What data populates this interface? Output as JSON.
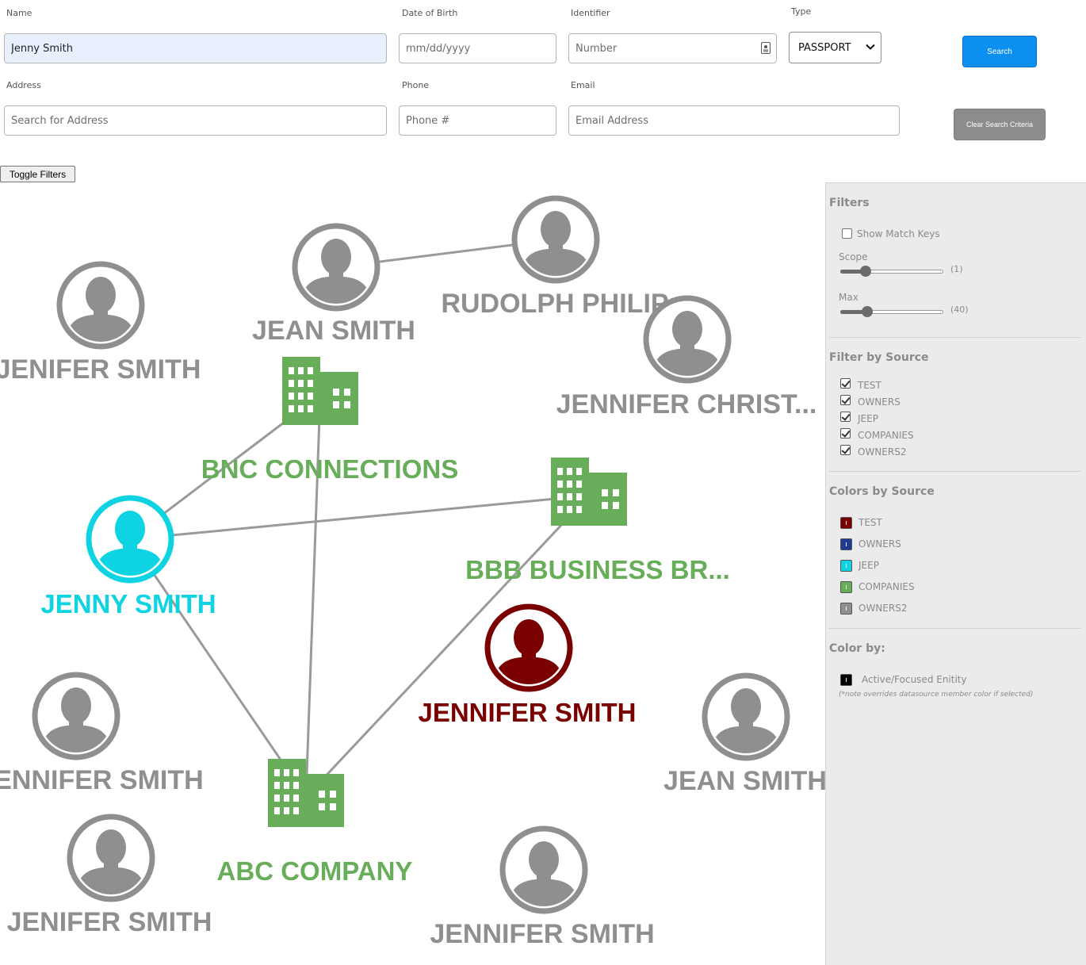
{
  "search": {
    "name_label": "Name",
    "name_value": "Jenny Smith",
    "dob_label": "Date of Birth",
    "dob_placeholder": "mm/dd/yyyy",
    "identifier_label": "Identifier",
    "identifier_placeholder": "Number",
    "type_label": "Type",
    "type_value": "PASSPORT",
    "search_button": "Search",
    "address_label": "Address",
    "address_placeholder": "Search for Address",
    "phone_label": "Phone",
    "phone_placeholder": "Phone #",
    "email_label": "Email",
    "email_placeholder": "Email Address",
    "clear_button": "Clear Search Criteria",
    "toggle_filters": "Toggle Filters"
  },
  "graph": {
    "nodes": [
      {
        "id": "jean-smith-top",
        "kind": "person",
        "label": "JEAN SMITH",
        "color": "#8f8f8f"
      },
      {
        "id": "rudolph",
        "kind": "person",
        "label": "RUDOLPH PHILIP",
        "color": "#8f8f8f"
      },
      {
        "id": "jenifer-left",
        "kind": "person",
        "label": "JENIFER SMITH",
        "color": "#8f8f8f"
      },
      {
        "id": "jennifer-christ",
        "kind": "person",
        "label": "JENNIFER CHRIST...",
        "color": "#8f8f8f"
      },
      {
        "id": "bnc",
        "kind": "company",
        "label": "BNC CONNECTIONS",
        "color": "#68ad5a"
      },
      {
        "id": "bbb",
        "kind": "company",
        "label": "BBB BUSINESS BR...",
        "color": "#68ad5a"
      },
      {
        "id": "jenny",
        "kind": "person",
        "label": "JENNY SMITH",
        "color": "#0ed3e3"
      },
      {
        "id": "jennifer-red",
        "kind": "person",
        "label": "JENNIFER SMITH",
        "color": "#7a0000"
      },
      {
        "id": "jennifer-bl",
        "kind": "person",
        "label": "JENNIFER SMITH",
        "color": "#8f8f8f"
      },
      {
        "id": "jean-smith-right",
        "kind": "person",
        "label": "JEAN SMITH",
        "color": "#8f8f8f"
      },
      {
        "id": "abc",
        "kind": "company",
        "label": "ABC COMPANY",
        "color": "#68ad5a"
      },
      {
        "id": "jenifer-bottom",
        "kind": "person",
        "label": "JENIFER SMITH",
        "color": "#8f8f8f"
      },
      {
        "id": "jennifer-bottom",
        "kind": "person",
        "label": "JENNIFER SMITH",
        "color": "#8f8f8f"
      }
    ],
    "edges": [
      [
        "jean-smith-top",
        "rudolph"
      ],
      [
        "bnc",
        "jenny"
      ],
      [
        "bnc",
        "abc"
      ],
      [
        "jenny",
        "bbb"
      ],
      [
        "jenny",
        "abc"
      ],
      [
        "bbb",
        "abc"
      ]
    ]
  },
  "filters": {
    "title": "Filters",
    "show_match_keys": "Show Match Keys",
    "show_match_keys_checked": false,
    "scope_label": "Scope",
    "scope_value": "(1)",
    "scope_level": 1,
    "max_label": "Max",
    "max_value": "(40)",
    "max_level": 40,
    "filter_by_source_title": "Filter by Source",
    "sources": [
      {
        "name": "TEST",
        "checked": true
      },
      {
        "name": "OWNERS",
        "checked": true
      },
      {
        "name": "JEEP",
        "checked": true
      },
      {
        "name": "COMPANIES",
        "checked": true
      },
      {
        "name": "OWNERS2",
        "checked": true
      }
    ],
    "colors_by_source_title": "Colors by Source",
    "colors": [
      {
        "name": "TEST",
        "color": "#7a0000"
      },
      {
        "name": "OWNERS",
        "color": "#1f3a93"
      },
      {
        "name": "JEEP",
        "color": "#0ed3e3"
      },
      {
        "name": "COMPANIES",
        "color": "#68ad5a"
      },
      {
        "name": "OWNERS2",
        "color": "#8f8f8f"
      }
    ],
    "color_by_title": "Color by:",
    "active_focused": "Active/Focused Enitity",
    "active_focused_color": "#000000",
    "note": "(*note overrides datasource member color if selected)"
  }
}
